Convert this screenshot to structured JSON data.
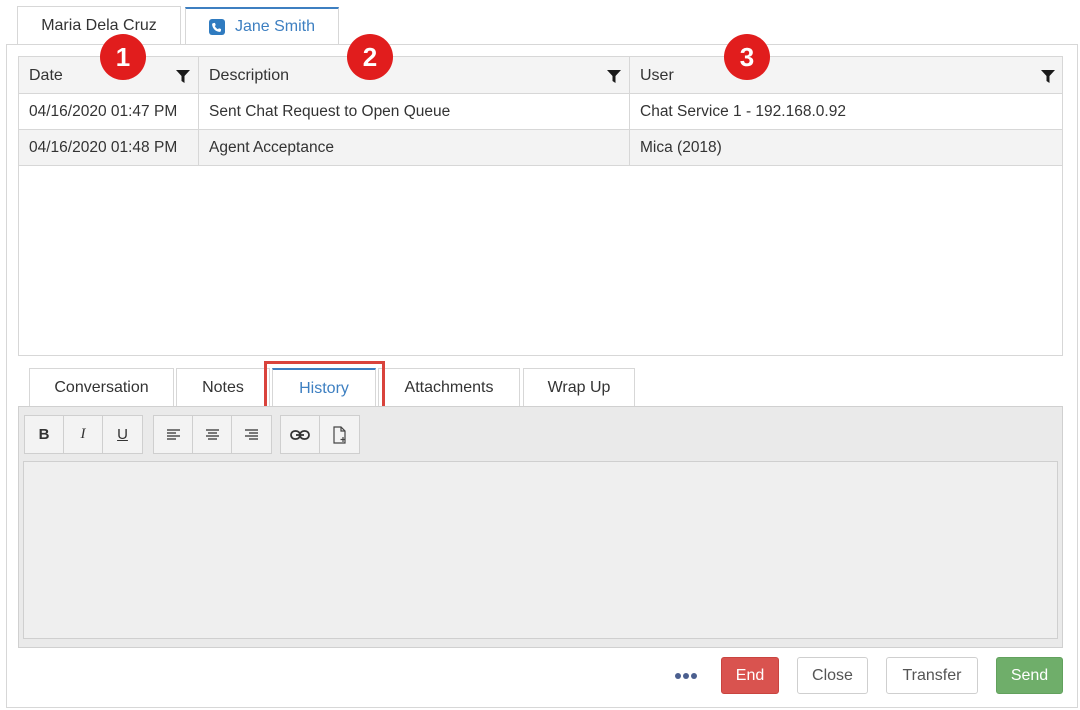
{
  "contact_tabs": [
    {
      "label": "Maria Dela Cruz",
      "active": false
    },
    {
      "label": "Jane Smith",
      "active": true,
      "icon": "phone-icon"
    }
  ],
  "grid": {
    "columns": [
      {
        "label": "Date",
        "icon": "filter-icon"
      },
      {
        "label": "Description",
        "icon": "filter-icon"
      },
      {
        "label": "User",
        "icon": "filter-icon"
      }
    ],
    "rows": [
      {
        "date": "04/16/2020 01:47 PM",
        "description": "Sent Chat Request to Open Queue",
        "user": "Chat Service 1 - 192.168.0.92"
      },
      {
        "date": "04/16/2020 01:48 PM",
        "description": "Agent Acceptance",
        "user": "Mica (2018)"
      }
    ]
  },
  "markers": [
    "1",
    "2",
    "3"
  ],
  "sub_tabs": [
    {
      "label": "Conversation",
      "active": false
    },
    {
      "label": "Notes",
      "active": false
    },
    {
      "label": "History",
      "active": true
    },
    {
      "label": "Attachments",
      "active": false
    },
    {
      "label": "Wrap Up",
      "active": false
    }
  ],
  "toolbar": {
    "bold": "B",
    "italic": "I",
    "underline": "U",
    "icons": [
      "align-left-icon",
      "align-center-icon",
      "align-right-icon",
      "link-icon",
      "insert-file-icon"
    ]
  },
  "actions": {
    "more_icon": "more-dots-icon",
    "end": "End",
    "close": "Close",
    "transfer": "Transfer",
    "send": "Send"
  },
  "colors": {
    "accent": "#3d7fc1",
    "marker": "#e11d1d",
    "highlight": "#d9433c",
    "end": "#d9534f",
    "send": "#6fae6a"
  }
}
